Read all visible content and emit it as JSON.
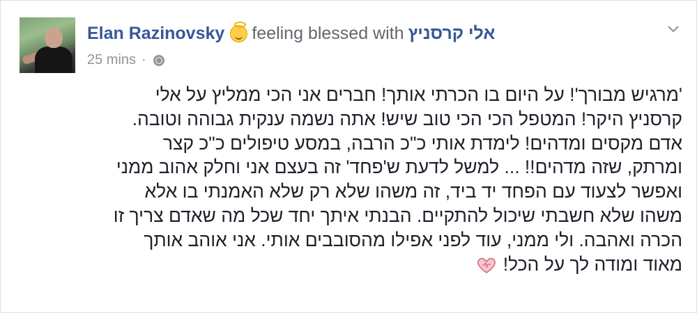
{
  "post": {
    "author_name": "Elan Razinovsky",
    "feeling_text": "feeling blessed with",
    "tagged_name": "אלי קרסניץ",
    "timestamp": "25 mins",
    "separator": "·",
    "feeling_icon": "smiling-face-with-halo",
    "privacy_icon": "globe-icon",
    "menu_icon": "chevron-down-icon",
    "body_lines": [
      "'מרגיש מבורך'! על היום בו הכרתי אותך! חברים אני הכי ממליץ על אלי",
      "קרסניץ היקר! המטפל הכי הכי טוב שיש! אתה נשמה ענקית גבוהה וטובה.",
      "אדם מקסים ומדהים! לימדת אותי כ\"כ הרבה, במסע טיפולים כ\"כ קצר",
      "ומרתק, שזה מדהים!! ... למשל לדעת ש'פחד' זה בעצם אני וחלק אהוב ממני",
      "ואפשר לצעוד עם הפחד יד ביד, זה משהו שלא רק שלא האמנתי בו אלא",
      "משהו שלא חשבתי שיכול להתקיים. הבנתי איתך יחד שכל מה שאדם צריך זו",
      "הכרה ואהבה. ולי ממני, עוד לפני אפילו מהסובבים אותי. אני אוהב אותך",
      "מאוד ומודה לך על הכל!"
    ],
    "end_icon": "sparkling-heart-icon"
  },
  "colors": {
    "link": "#365899",
    "meta": "#90949c",
    "text": "#1d2129",
    "heart": "#f0a0b0"
  }
}
